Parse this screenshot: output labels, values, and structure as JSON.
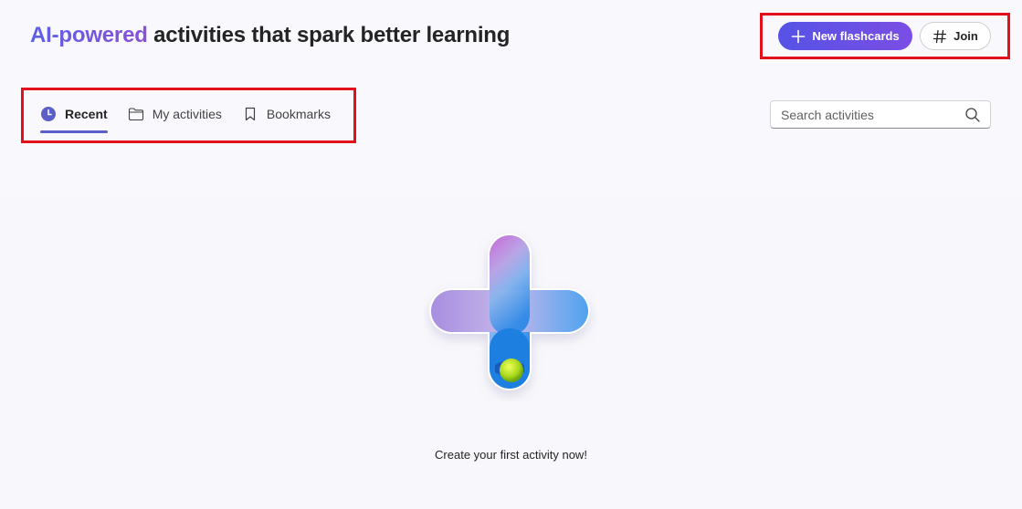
{
  "header": {
    "headline_accent": "AI-powered",
    "headline_rest": " activities that spark better learning"
  },
  "actions": {
    "new_flashcards_label": "New flashcards",
    "join_label": "Join",
    "primary_color": "#5b56e6"
  },
  "tabs": [
    {
      "label": "Recent",
      "icon": "clock-icon",
      "active": true
    },
    {
      "label": "My activities",
      "icon": "folder-icon",
      "active": false
    },
    {
      "label": "Bookmarks",
      "icon": "bookmark-icon",
      "active": false
    }
  ],
  "search": {
    "placeholder": "Search activities",
    "value": ""
  },
  "empty_state": {
    "illustration": "plus-illustration",
    "message": "Create your first activity now!"
  },
  "highlight_color": "#e2101b"
}
